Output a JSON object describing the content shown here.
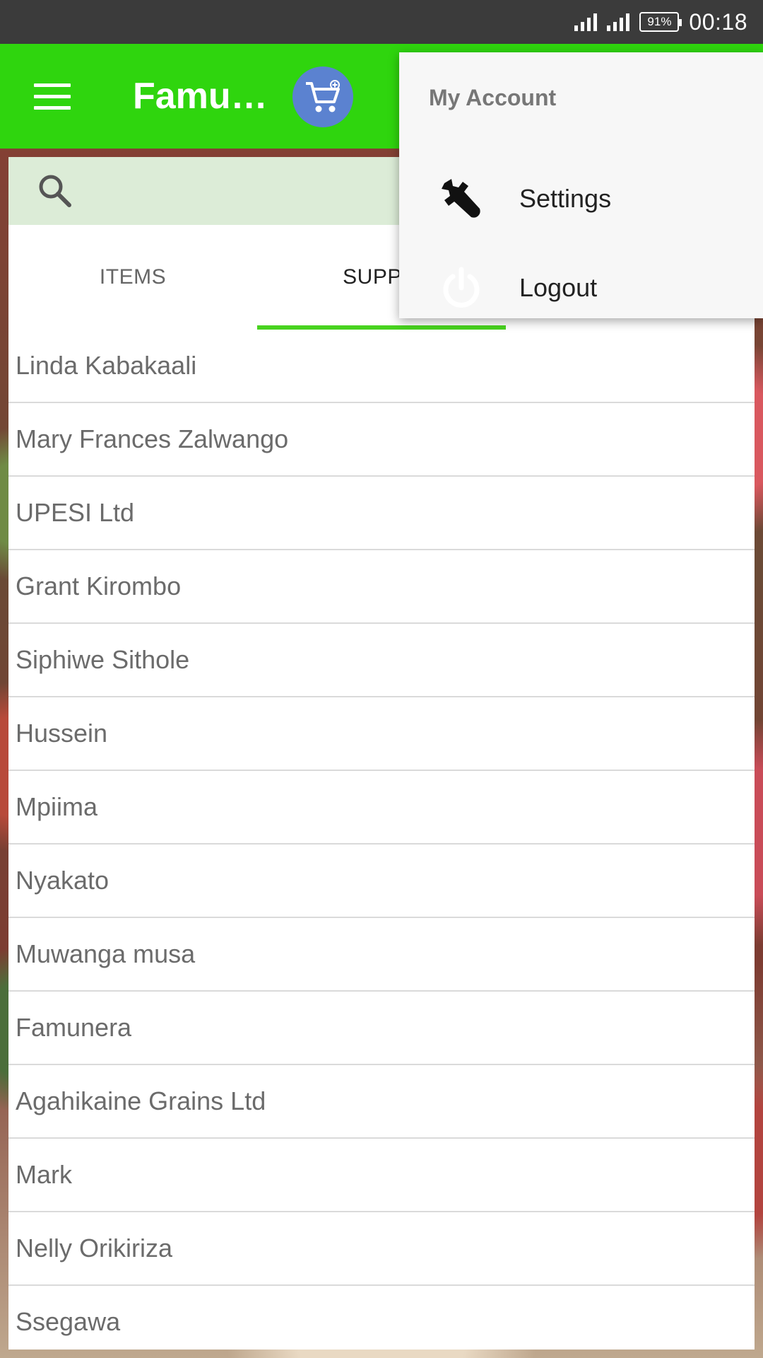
{
  "status_bar": {
    "battery": "91%",
    "time": "00:18"
  },
  "app_bar": {
    "title": "Famu…"
  },
  "tabs": [
    {
      "label": "ITEMS",
      "active": false
    },
    {
      "label": "SUPPLI",
      "active": true
    }
  ],
  "suppliers": [
    "Linda Kabakaali",
    "Mary Frances Zalwango",
    "UPESI Ltd",
    "Grant Kirombo",
    "Siphiwe Sithole",
    "Hussein",
    "Mpiima",
    "Nyakato",
    "Muwanga musa",
    "Famunera",
    "Agahikaine Grains Ltd",
    "Mark",
    "Nelly Orikiriza",
    "Ssegawa"
  ],
  "account_menu": {
    "title": "My Account",
    "items": [
      {
        "label": "Settings",
        "icon": "wrench-icon"
      },
      {
        "label": "Logout",
        "icon": "power-icon"
      }
    ]
  },
  "colors": {
    "accent": "#2fd50e",
    "tab_indicator": "#48d31f",
    "cart_button": "#5b82d0"
  }
}
